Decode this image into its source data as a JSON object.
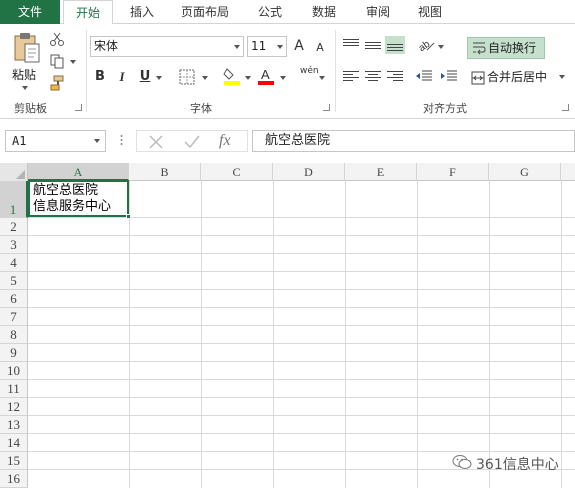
{
  "ribbon": {
    "tabs": [
      "文件",
      "开始",
      "插入",
      "页面布局",
      "公式",
      "数据",
      "审阅",
      "视图"
    ],
    "active_tab": 1,
    "clipboard": {
      "paste_label": "粘贴",
      "group_label": "剪贴板"
    },
    "font": {
      "name": "宋体",
      "size": "11",
      "group_label": "字体",
      "bold": "B",
      "italic": "I",
      "underline": "U",
      "grow": "A",
      "shrink": "A",
      "phonetic": "wén"
    },
    "alignment": {
      "wrap_label": "自动换行",
      "merge_label": "合并后居中",
      "group_label": "对齐方式"
    },
    "colors": {
      "accent": "#217346",
      "wrap_active": "#c6e0ce",
      "fill_color": "#ffff00",
      "font_color": "#ff0000"
    }
  },
  "formula_bar": {
    "cell_ref": "A1",
    "fx_label": "fx",
    "content": "航空总医院"
  },
  "sheet": {
    "columns": [
      "A",
      "B",
      "C",
      "D",
      "E",
      "F",
      "G"
    ],
    "rows": [
      "1",
      "2",
      "3",
      "4",
      "5",
      "6",
      "7",
      "8",
      "9",
      "10",
      "11",
      "12",
      "13",
      "14",
      "15",
      "16"
    ],
    "selected_column": "A",
    "selected_row": "1",
    "cell_a1": {
      "line1": "航空总医院",
      "line2": "信息服务中心"
    }
  },
  "watermark": "361信息中心"
}
